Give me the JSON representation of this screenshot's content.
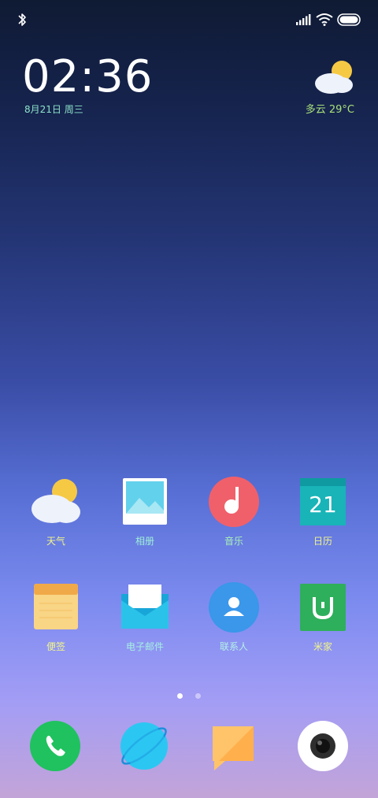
{
  "lock": {
    "time": "02:36",
    "date": "8月21日 周三",
    "weather": "多云 29°C"
  },
  "apps_row1": [
    {
      "label": "天气",
      "icon": "weather-icon",
      "color": "#f6c945"
    },
    {
      "label": "相册",
      "icon": "gallery-icon",
      "color": "#5fd3e8"
    },
    {
      "label": "音乐",
      "icon": "music-icon",
      "color": "#f0606a"
    },
    {
      "label": "日历",
      "icon": "calendar-icon",
      "color": "#18b4b8",
      "day": "21"
    }
  ],
  "apps_row2": [
    {
      "label": "便签",
      "icon": "notes-icon",
      "color": "#f6c26c"
    },
    {
      "label": "电子邮件",
      "icon": "email-icon",
      "color": "#1fb3e0"
    },
    {
      "label": "联系人",
      "icon": "contacts-icon",
      "color": "#3a97ea"
    },
    {
      "label": "米家",
      "icon": "mihome-icon",
      "color": "#2eaf5b"
    }
  ],
  "dock": [
    {
      "icon": "phone-icon",
      "color": "#1fc25e"
    },
    {
      "icon": "browser-icon",
      "color": "#2bc7f2"
    },
    {
      "icon": "messages-icon",
      "color": "#ffc46a"
    },
    {
      "icon": "camera-icon",
      "color": "#ffffff"
    }
  ],
  "page_indicator": {
    "current": 1,
    "total": 2
  }
}
